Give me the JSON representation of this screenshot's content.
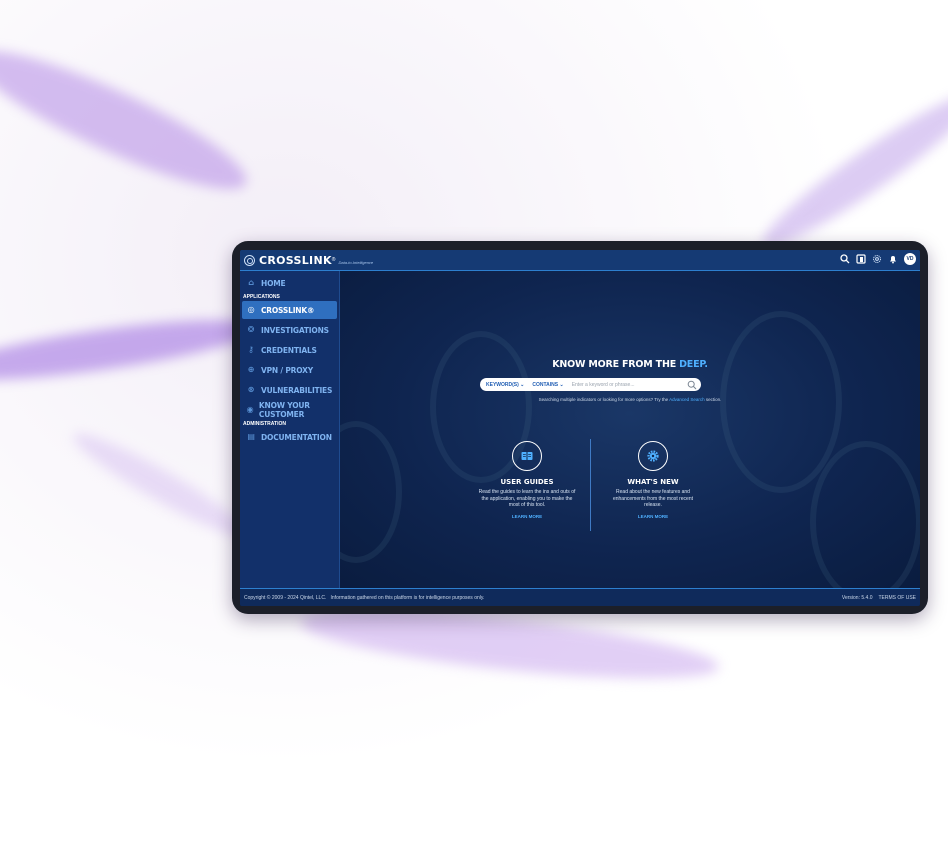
{
  "brand": {
    "name": "CROSSLINK",
    "registered": "®",
    "tagline": "Data-to-Intelligence"
  },
  "topbar": {
    "icons": [
      "search-icon",
      "data-icon",
      "settings-icon",
      "bell-icon"
    ],
    "avatar_initials": "VD"
  },
  "sidebar": {
    "home": {
      "label": "HOME",
      "icon": "home-icon"
    },
    "applications_heading": "APPLICATIONS",
    "applications": [
      {
        "label": "CROSSLINK®",
        "icon": "crosslink-icon",
        "active": true
      },
      {
        "label": "INVESTIGATIONS",
        "icon": "investigations-icon",
        "active": false
      },
      {
        "label": "CREDENTIALS",
        "icon": "credentials-icon",
        "active": false
      },
      {
        "label": "VPN / PROXY",
        "icon": "vpn-icon",
        "active": false
      },
      {
        "label": "VULNERABILITIES",
        "icon": "vulnerabilities-icon",
        "active": false
      },
      {
        "label": "KNOW YOUR CUSTOMER",
        "icon": "kyc-icon",
        "active": false
      }
    ],
    "administration_heading": "ADMINISTRATION",
    "administration": [
      {
        "label": "DOCUMENTATION",
        "icon": "documentation-icon"
      }
    ]
  },
  "hero": {
    "title_prefix": "KNOW MORE FROM THE ",
    "title_accent": "DEEP."
  },
  "search": {
    "field_dropdown": "KEYWORD(S) ⌄",
    "operator_dropdown": "CONTAINS ⌄",
    "placeholder": "Enter a keyword or phrase...",
    "hint_prefix": "Searching multiple indicators or looking for more options? Try the ",
    "hint_link": "Advanced Search",
    "hint_suffix": " section."
  },
  "cards": [
    {
      "icon": "book-icon",
      "title": "USER GUIDES",
      "description": "Read the guides to learn the ins and outs of the application, enabling you to make the most of this tool.",
      "link": "LEARN MORE"
    },
    {
      "icon": "gear-icon",
      "title": "WHAT'S NEW",
      "description": "Read about the new features and enhancements from the most recent release.",
      "link": "LEARN MORE"
    }
  ],
  "footer": {
    "copyright": "Copyright © 2009 - 2024 Qintel, LLC.   Information gathered on this platform is for intelligence purposes only.",
    "version": "Version: 5.4.0",
    "terms": "TERMS OF USE"
  },
  "colors": {
    "accent": "#4fb0ff",
    "topbar": "#153a74",
    "sidebar": "#12306a",
    "active_item": "#2f6fbf"
  }
}
